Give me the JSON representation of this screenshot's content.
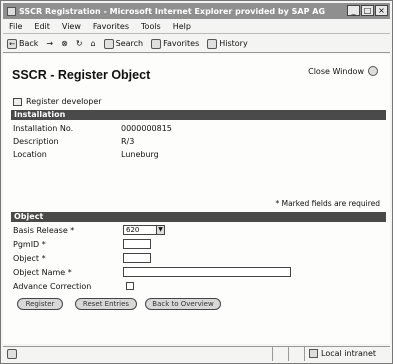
{
  "window": {
    "title": "SSCR Registration - Microsoft Internet Explorer provided by SAP AG",
    "minimize": "_",
    "maximize": "□",
    "close": "×"
  },
  "menu": [
    "File",
    "Edit",
    "View",
    "Favorites",
    "Tools",
    "Help"
  ],
  "toolbar": {
    "back": "Back",
    "forward": "→",
    "stop": "⊗",
    "refresh": "↻",
    "home": "⌂",
    "search": "Search",
    "favorites": "Favorites",
    "history": "History"
  },
  "page": {
    "title": "SSCR - Register Object",
    "close_window": "Close Window",
    "register_developer": "Register developer",
    "required_note": "* Marked fields are required"
  },
  "installation": {
    "header": "Installation",
    "rows": [
      {
        "label": "Installation No.",
        "value": "0000000815"
      },
      {
        "label": "Description",
        "value": "R/3"
      },
      {
        "label": "Location",
        "value": "Luneburg"
      }
    ]
  },
  "object": {
    "header": "Object",
    "basis_release_label": "Basis Release *",
    "basis_release_value": "620",
    "pgmid_label": "PgmID *",
    "object_label": "Object *",
    "object_name_label": "Object Name *",
    "advance_correction_label": "Advance Correction"
  },
  "buttons": [
    "Register",
    "Reset Entries",
    "Back to Overview"
  ],
  "status": {
    "zone": "Local intranet"
  }
}
